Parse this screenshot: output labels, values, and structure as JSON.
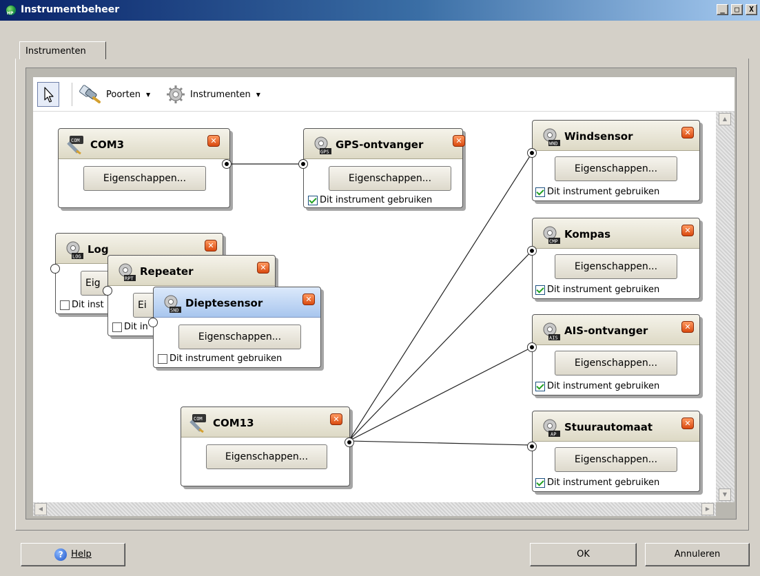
{
  "window": {
    "title": "Instrumentbeheer",
    "controls": {
      "minimize": "_",
      "maximize": "□",
      "close": "X"
    }
  },
  "tabs": [
    {
      "label": "Instrumenten",
      "active": true
    }
  ],
  "toolbar": {
    "pointer_icon": "arrow-pointer-icon",
    "ports_label": "Poorten",
    "instruments_label": "Instrumenten"
  },
  "nodes": {
    "com3": {
      "title": "COM3",
      "button": "Eigenschappen..."
    },
    "gps": {
      "title": "GPS-ontvanger",
      "button": "Eigenschappen...",
      "checkbox_label": "Dit instrument gebruiken",
      "checked": true,
      "badge": "GPS"
    },
    "log": {
      "title": "Log",
      "button": "Eig",
      "checkbox_label": "Dit inst",
      "checked": false,
      "badge": "LOG"
    },
    "repeater": {
      "title": "Repeater",
      "button": "Ei",
      "checkbox_label": "Dit in",
      "checked": false,
      "badge": "RPT"
    },
    "depth": {
      "title": "Dieptesensor",
      "button": "Eigenschappen...",
      "checkbox_label": "Dit instrument gebruiken",
      "checked": false,
      "badge": "SND"
    },
    "com13": {
      "title": "COM13",
      "button": "Eigenschappen..."
    },
    "wind": {
      "title": "Windsensor",
      "button": "Eigenschappen...",
      "checkbox_label": "Dit instrument gebruiken",
      "checked": true,
      "badge": "WND"
    },
    "compass": {
      "title": "Kompas",
      "button": "Eigenschappen...",
      "checkbox_label": "Dit instrument gebruiken",
      "checked": true,
      "badge": "CMP"
    },
    "ais": {
      "title": "AIS-ontvanger",
      "button": "Eigenschappen...",
      "checkbox_label": "Dit instrument gebruiken",
      "checked": true,
      "badge": "AIS"
    },
    "autopilot": {
      "title": "Stuurautomaat",
      "button": "Eigenschappen...",
      "checkbox_label": "Dit instrument gebruiken",
      "checked": true,
      "badge": "AP"
    }
  },
  "port_badge": "COM",
  "close_glyph": "✕",
  "footer": {
    "help_label": "Help",
    "ok_label": "OK",
    "cancel_label": "Annuleren"
  },
  "colors": {
    "titlebar_start": "#0a246a",
    "selected_header": "#a8c6ee",
    "close_button": "#e0601c",
    "check_green": "#21a121"
  }
}
